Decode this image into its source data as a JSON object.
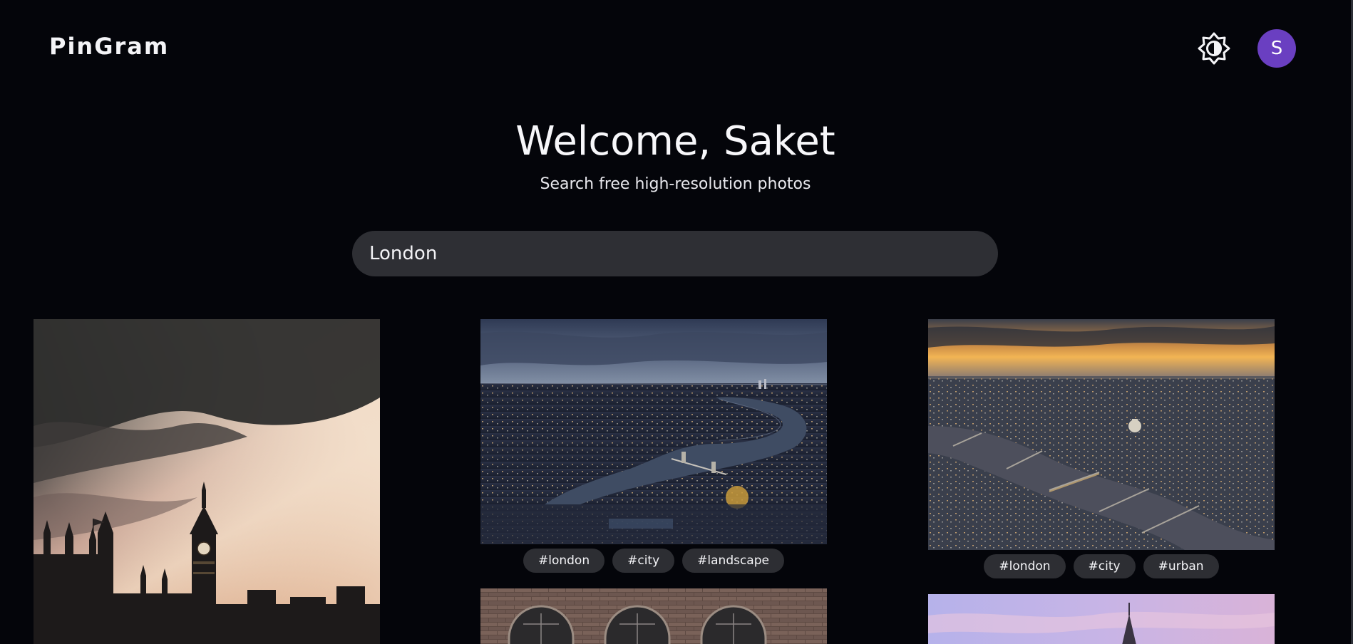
{
  "header": {
    "logo": "PinGram",
    "theme_toggle_icon": "brightness-icon",
    "avatar_initial": "S"
  },
  "hero": {
    "title": "Welcome, Saket",
    "subtitle": "Search free high-resolution photos"
  },
  "search": {
    "value": "London"
  },
  "photos": [
    {
      "tags": []
    },
    {
      "tags": [
        "#london",
        "#city",
        "#landscape"
      ]
    },
    {
      "tags": [
        "#london",
        "#city",
        "#urban"
      ]
    },
    {
      "tags": []
    },
    {
      "tags": []
    }
  ],
  "colors": {
    "background": "#04050a",
    "surface": "#2e2f34",
    "avatar": "#6a3fc1"
  }
}
